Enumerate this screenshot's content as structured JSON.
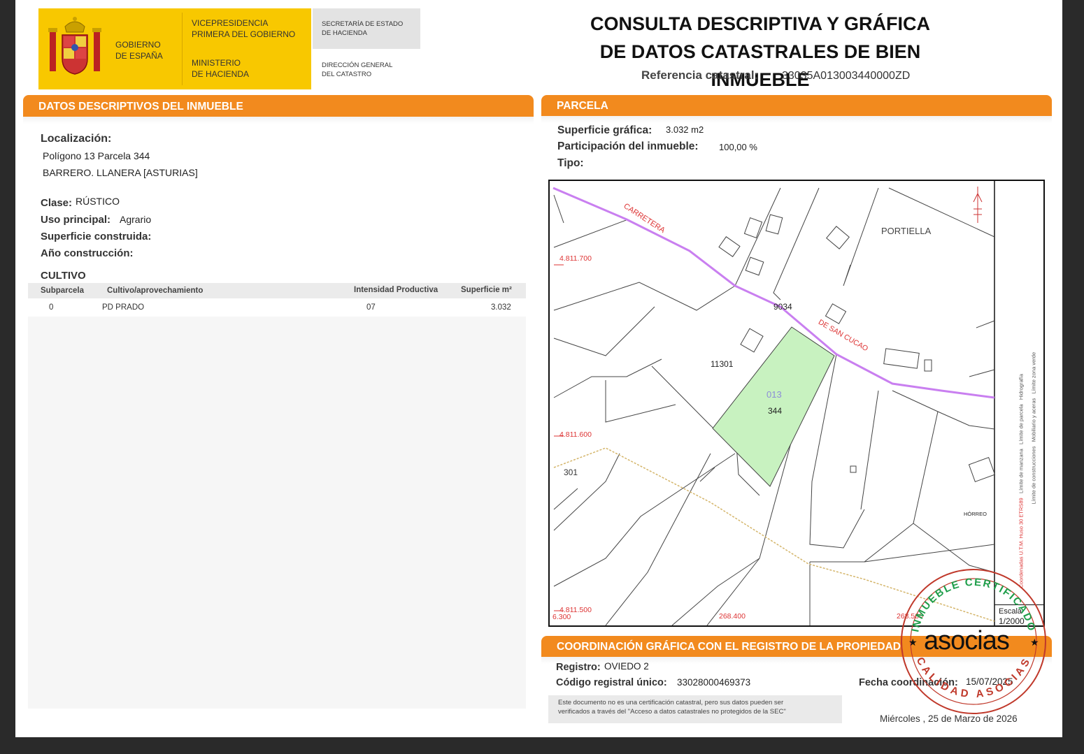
{
  "header": {
    "gov1": "GOBIERNO",
    "gov2": "DE ESPAÑA",
    "vice1": "VICEPRESIDENCIA",
    "vice2": "PRIMERA DEL GOBIERNO",
    "min1": "MINISTERIO",
    "min2": "DE HACIENDA",
    "sec1": "SECRETARÍA DE ESTADO",
    "sec2": "DE HACIENDA",
    "dir1": "DIRECCIÓN GENERAL",
    "dir2": "DEL CATASTRO",
    "title1": "CONSULTA DESCRIPTIVA Y GRÁFICA",
    "title2": "DE DATOS CATASTRALES DE BIEN INMUEBLE",
    "ref_label": "Referencia catastral:",
    "ref_value": "33035A013003440000ZD"
  },
  "desc": {
    "section_title": "DATOS DESCRIPTIVOS DEL INMUEBLE",
    "loc_label": "Localización:",
    "loc_line1": "Polígono 13 Parcela 344",
    "loc_line2": "BARRERO. LLANERA [ASTURIAS]",
    "clase_label": "Clase:",
    "clase_value": "RÚSTICO",
    "uso_label": "Uso principal:",
    "uso_value": "Agrario",
    "sup_label": "Superficie construida:",
    "anio_label": "Año construcción:",
    "cultivo_title": "CULTIVO",
    "columns": [
      "Subparcela",
      "Cultivo/aprovechamiento",
      "Intensidad Productiva",
      "Superficie m²"
    ],
    "rows": [
      {
        "sub": "0",
        "cultivo": "PD PRADO",
        "intensidad": "07",
        "superficie": "3.032"
      }
    ]
  },
  "parcela": {
    "section_title": "PARCELA",
    "sup_label": "Superficie gráfica:",
    "sup_value": "3.032 m2",
    "part_label": "Participación del inmueble:",
    "part_value": "100,00 %",
    "tipo_label": "Tipo:"
  },
  "map": {
    "labels": {
      "carretera": "CARRETERA",
      "sancucao": "DE SAN CUCAO",
      "portiella": "PORTIELLA",
      "p9034": "9034",
      "p11301": "11301",
      "poly": "013",
      "parcel": "344",
      "p301": "301",
      "horreo": "HÓRREO",
      "y1": "4.811.700",
      "y2": "4.811.600",
      "y3": "4.811.500",
      "x0": "6.300",
      "x1": "268.400",
      "x2": "268.500",
      "escala1": "Escala",
      "escala2": "1/2000"
    },
    "legend": [
      "Límite zona verde",
      "Hidrografía",
      "Límite de parcela",
      "Mobiliario y aceras",
      "Límite de construcciones",
      "Límite de manzana",
      "Coordenadas U.T.M. Huso 30 ETRS89"
    ],
    "colors": {
      "parcel_fill": "#c8f2c0",
      "road": "#c97ff0",
      "coords": "#d33",
      "boundary": "#d4b56a"
    }
  },
  "registro": {
    "section_title": "COORDINACIÓN GRÁFICA CON EL REGISTRO DE LA PROPIEDAD",
    "reg_label": "Registro:",
    "reg_value": "OVIEDO 2",
    "codigo_label": "Código registral único:",
    "codigo_value": "33028000469373",
    "fecha_label": "Fecha coordinación:",
    "fecha_value": "15/07/2025",
    "note1": "Este documento no es una certificación catastral, pero sus datos pueden ser",
    "note2": "verificados a través del \"Acceso a datos catastrales no protegidos de la SEC\"",
    "date": "Miércoles , 25 de Marzo de 2026"
  },
  "stamp": {
    "top": "INMUEBLE CERTIFICADO",
    "brand": "asocias",
    "bottom": "CALIDAD ASOCIAS",
    "color_red": "#c0392b",
    "color_green": "#1e9e4a"
  }
}
